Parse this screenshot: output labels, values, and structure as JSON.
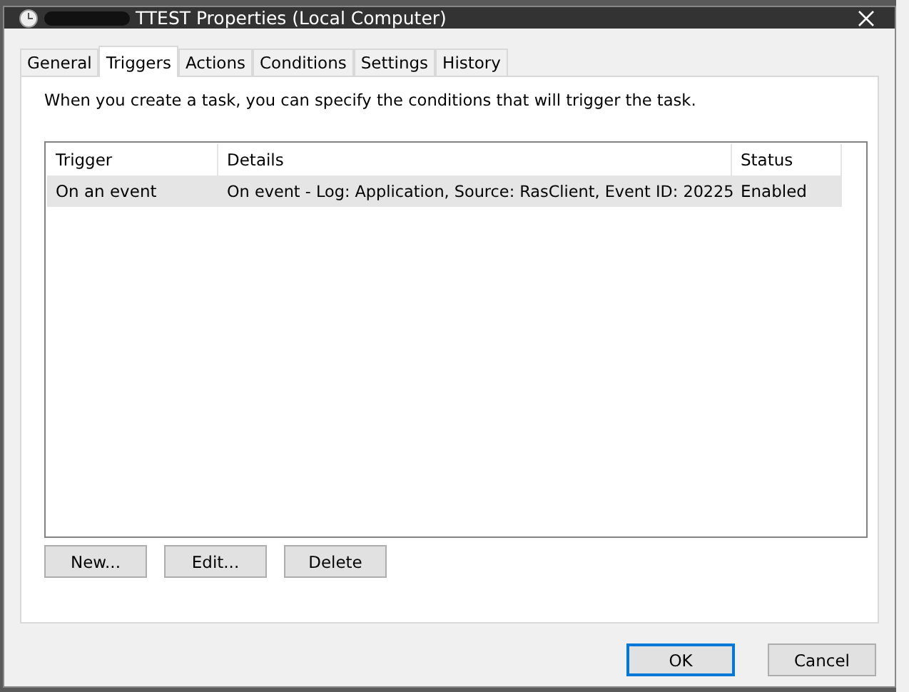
{
  "window": {
    "title": "TTEST Properties (Local Computer)"
  },
  "tabs": [
    {
      "label": "General",
      "selected": false
    },
    {
      "label": "Triggers",
      "selected": true
    },
    {
      "label": "Actions",
      "selected": false
    },
    {
      "label": "Conditions",
      "selected": false
    },
    {
      "label": "Settings",
      "selected": false
    },
    {
      "label": "History",
      "selected": false
    }
  ],
  "description": "When you create a task, you can specify the conditions that will trigger the task.",
  "table": {
    "columns": [
      "Trigger",
      "Details",
      "Status"
    ],
    "rows": [
      {
        "cells": [
          "On an event",
          "On event - Log: Application, Source: RasClient, Event ID: 20225",
          "Enabled"
        ],
        "selected": true
      }
    ]
  },
  "table_buttons": [
    "New...",
    "Edit...",
    "Delete"
  ],
  "dialog_buttons": [
    {
      "label": "OK",
      "default": true
    },
    {
      "label": "Cancel",
      "default": false
    }
  ]
}
